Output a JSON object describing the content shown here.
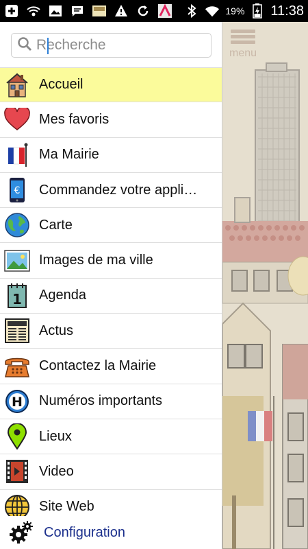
{
  "status_bar": {
    "battery_percent": "19%",
    "time": "11:38",
    "icons": [
      "add-icon",
      "wifi-calling-icon",
      "image-icon",
      "chat-icon",
      "ad-icon",
      "warning-icon",
      "sync-icon",
      "app-icon",
      "bluetooth-icon",
      "wifi-icon",
      "battery-icon"
    ]
  },
  "background_app": {
    "menu_label": "menu"
  },
  "drawer": {
    "search": {
      "placeholder": "Recherche",
      "value": ""
    },
    "items": [
      {
        "label": "Accueil",
        "icon": "house-icon",
        "active": true
      },
      {
        "label": "Mes favoris",
        "icon": "heart-icon"
      },
      {
        "label": "Ma Mairie",
        "icon": "french-flag-icon"
      },
      {
        "label": "Commandez votre appli…",
        "icon": "phone-euro-icon"
      },
      {
        "label": "Carte",
        "icon": "globe-icon"
      },
      {
        "label": "Images de ma ville",
        "icon": "picture-icon"
      },
      {
        "label": "Agenda",
        "icon": "calendar-icon"
      },
      {
        "label": "Actus",
        "icon": "newspaper-icon"
      },
      {
        "label": "Contactez la Mairie",
        "icon": "telephone-icon"
      },
      {
        "label": "Numéros importants",
        "icon": "hospital-icon"
      },
      {
        "label": "Lieux",
        "icon": "map-pin-icon"
      },
      {
        "label": "Video",
        "icon": "film-icon"
      },
      {
        "label": "Site Web",
        "icon": "web-globe-icon"
      }
    ],
    "config_label": "Configuration"
  },
  "colors": {
    "active_row": "#fbfb9b",
    "config_text": "#1b2f8c"
  }
}
